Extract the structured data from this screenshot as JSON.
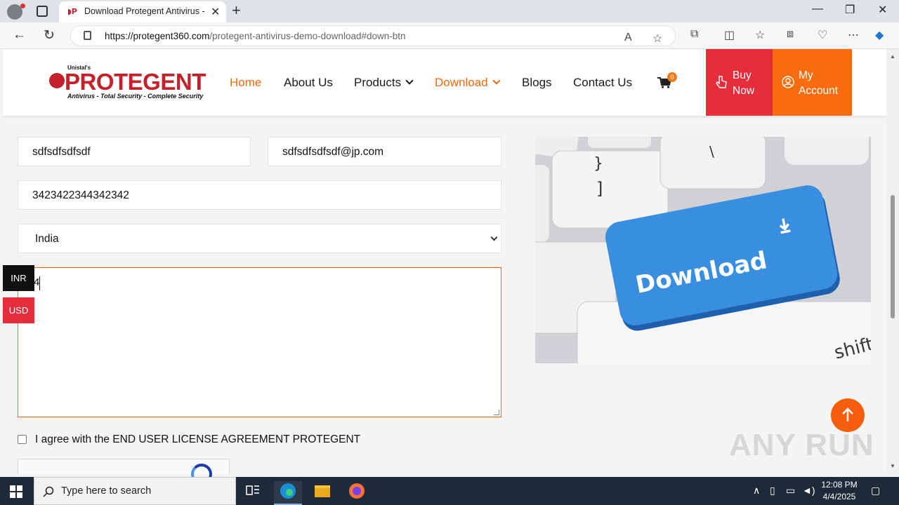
{
  "browser": {
    "tab_title": "Download Protegent Antivirus - F",
    "favicon_text": "◗P",
    "url_host": "https://protegent360.com",
    "url_path": "/protegent-antivirus-demo-download#down-btn"
  },
  "site": {
    "logo": {
      "brand_prefix": "Unistal's",
      "brand": "PROTEGENT",
      "tagline": "Antivirus - Total Security - Complete Security"
    },
    "nav": [
      {
        "label": "Home",
        "active": true
      },
      {
        "label": "About Us"
      },
      {
        "label": "Products",
        "dropdown": true
      },
      {
        "label": "Download",
        "dropdown": true,
        "highlight": true
      },
      {
        "label": "Blogs"
      },
      {
        "label": "Contact Us"
      }
    ],
    "cart_count": "0",
    "buy_now": "Buy Now",
    "my_account": "My Account",
    "colors": {
      "accent": "#f06a14",
      "buy": "#e52d3c",
      "account": "#f96d0e"
    }
  },
  "form": {
    "name_value": "sdfsdfsdfsdf",
    "email_value": "sdfsdfsdfsdf@jp.com",
    "phone_value": "3423422344342342",
    "country_value": "India",
    "message_value": "4",
    "agree_label": "I agree with the END USER LICENSE AGREEMENT PROTEGENT",
    "agree_checked": false
  },
  "currency": {
    "inr": "INR",
    "usd": "USD"
  },
  "image": {
    "key_label": "Download",
    "shift_label": "shift"
  },
  "watermark": "ANY RUN",
  "taskbar": {
    "search_placeholder": "Type here to search",
    "time": "12:08 PM",
    "date": "4/4/2025"
  }
}
